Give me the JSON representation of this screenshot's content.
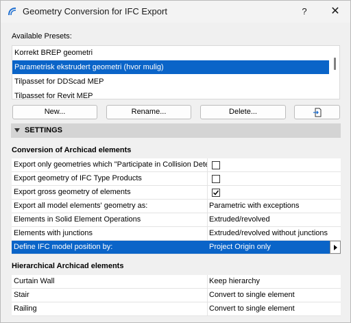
{
  "window": {
    "title": "Geometry Conversion for IFC Export",
    "help_label": "?",
    "close_label": "✕"
  },
  "presets": {
    "label": "Available Presets:",
    "items": [
      {
        "label": "Korrekt BREP geometri",
        "selected": false
      },
      {
        "label": "Parametrisk ekstrudert geometri (hvor mulig)",
        "selected": true
      },
      {
        "label": "Tilpasset for DDScad MEP",
        "selected": false
      },
      {
        "label": "Tilpasset for Revit MEP",
        "selected": false
      }
    ]
  },
  "buttons": {
    "new_label": "New...",
    "rename_label": "Rename...",
    "delete_label": "Delete...",
    "export_icon": "document-export-icon"
  },
  "settings": {
    "header": "SETTINGS",
    "conversion_title": "Conversion of Archicad elements",
    "conversion_rows": [
      {
        "name": "Export only geometries which \"Participate in Collision Detection\"",
        "type": "checkbox",
        "checked": false
      },
      {
        "name": "Export geometry of IFC Type Products",
        "type": "checkbox",
        "checked": false
      },
      {
        "name": "Export gross geometry of elements",
        "type": "checkbox",
        "checked": true
      },
      {
        "name": "Export all model elements' geometry as:",
        "type": "value",
        "value": "Parametric with exceptions"
      },
      {
        "name": "Elements in Solid Element Operations",
        "type": "value",
        "value": "Extruded/revolved"
      },
      {
        "name": "Elements with junctions",
        "type": "value",
        "value": "Extruded/revolved without junctions"
      },
      {
        "name": "Define IFC model position by:",
        "type": "value",
        "value": "Project Origin only",
        "selected": true
      }
    ],
    "hierarchical_title": "Hierarchical Archicad elements",
    "hierarchical_rows": [
      {
        "name": "Curtain Wall",
        "value": "Keep hierarchy"
      },
      {
        "name": "Stair",
        "value": "Convert to single element"
      },
      {
        "name": "Railing",
        "value": "Convert to single element"
      }
    ]
  },
  "colors": {
    "selection": "#0a64c8",
    "background": "#f0f0f0",
    "header_bar": "#d4d4d4"
  }
}
